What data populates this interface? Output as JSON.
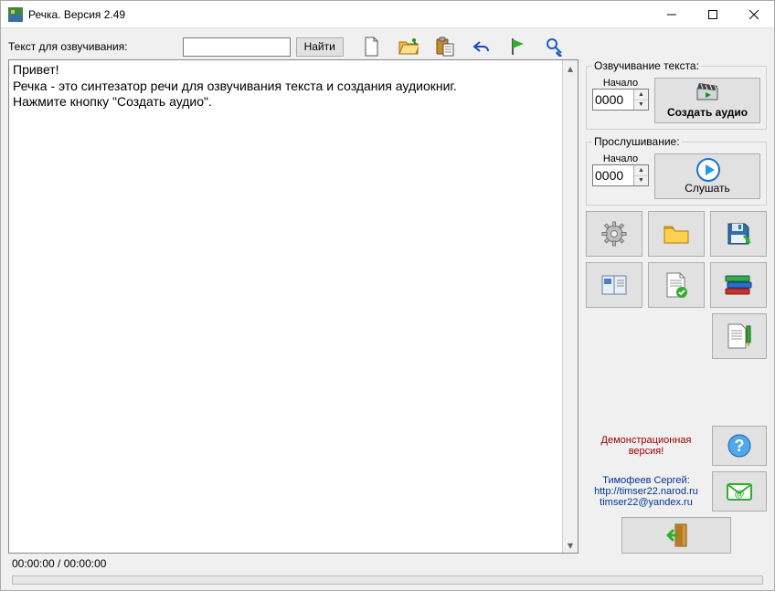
{
  "window": {
    "title": "Речка. Версия 2.49"
  },
  "top": {
    "label": "Текст для озвучивания:",
    "search_value": "",
    "find_label": "Найти"
  },
  "editor": {
    "text": "Привет!\nРечка - это синтезатор речи для озвучивания текста и создания аудиокниг.\nНажмите кнопку \"Создать аудио\"."
  },
  "voice_group": {
    "legend": "Озвучивание текста:",
    "start_label": "Начало",
    "start_value": "0000",
    "create_label": "Создать аудио"
  },
  "listen_group": {
    "legend": "Прослушивание:",
    "start_label": "Начало",
    "start_value": "0000",
    "listen_label": "Слушать"
  },
  "info": {
    "demo_line1": "Демонстрационная",
    "demo_line2": "версия!",
    "author": "Тимофеев Сергей:",
    "site": "http://timser22.narod.ru",
    "email": "timser22@yandex.ru"
  },
  "status": {
    "time": "00:00:00 / 00:00:00"
  },
  "icons": {
    "new": "new-file-icon",
    "open": "open-folder-icon",
    "paste": "clipboard-paste-icon",
    "undo": "undo-icon",
    "flag": "flag-icon",
    "wrench": "wrench-search-icon",
    "clapper": "clapperboard-icon",
    "play": "play-icon",
    "gear": "gear-icon",
    "folder": "folder-icon",
    "save": "floppy-icon",
    "book": "booklet-icon",
    "doc_check": "document-check-icon",
    "books": "books-stack-icon",
    "notes": "document-pencil-icon",
    "help": "help-icon",
    "mail": "mail-icon",
    "exit": "exit-door-icon"
  }
}
